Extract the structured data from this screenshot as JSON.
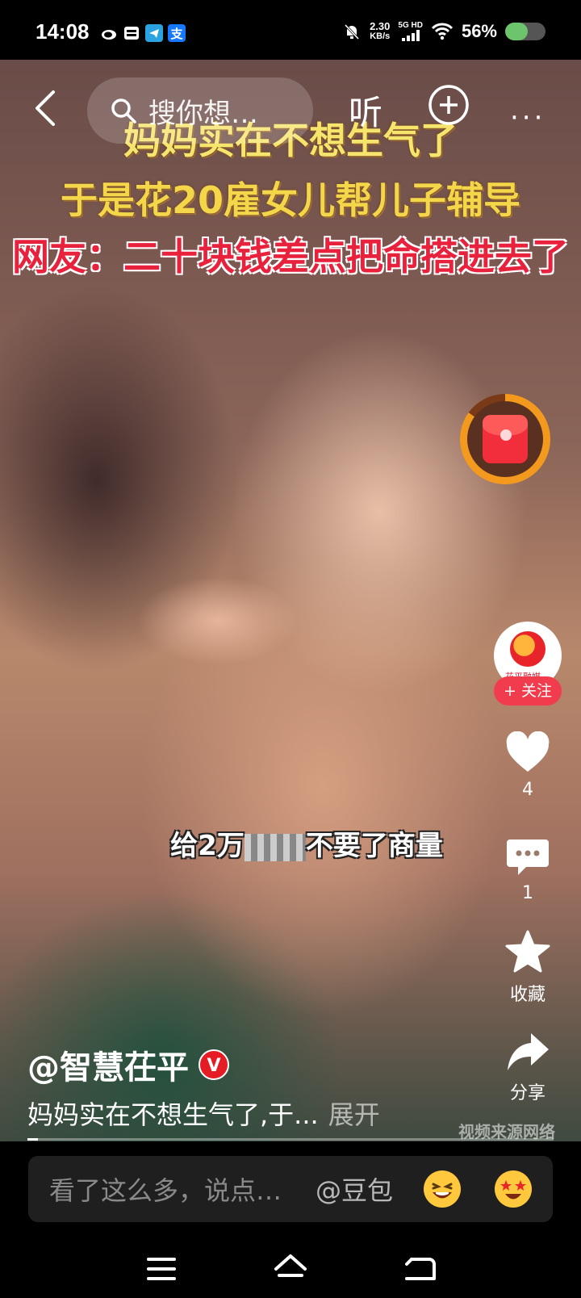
{
  "status_bar": {
    "time": "14:08",
    "net_speed_value": "2.30",
    "net_speed_unit": "KB/s",
    "signal_label": "5G HD",
    "battery_text": "56%",
    "battery_level": 0.56,
    "left_icons": [
      "weibo-icon",
      "sim-card-icon",
      "telegram-icon",
      "alipay-icon"
    ],
    "right_icons": [
      "mute-bell-icon",
      "signal-icon",
      "wifi-icon",
      "battery-icon"
    ]
  },
  "top_nav": {
    "search_placeholder": "搜你想…",
    "listen_label": "听",
    "more_label": "···"
  },
  "video": {
    "headline_1": "妈妈实在不想生气了",
    "headline_2": "于是花20雇女儿帮儿子辅导",
    "headline_3": "网友：二十块钱差点把命搭进去了",
    "subtitle_before": "给2万",
    "subtitle_after": "不要了商量",
    "watermark": "视频来源网络",
    "progress": 0.02
  },
  "sidebar": {
    "avatar_text": "花平融媒",
    "follow_label": "+ 关注",
    "like_count": "4",
    "comment_count": "1",
    "favorite_label": "收藏",
    "share_label": "分享"
  },
  "post": {
    "author": "@智慧茌平",
    "verified_badge": "V",
    "description": "妈妈实在不想生气了,于...",
    "expand_label": "展开"
  },
  "comment_bar": {
    "placeholder": "看了这么多，说点…",
    "mention": "@豆包"
  },
  "colors": {
    "accent_red": "#f03c4c",
    "redpacket_ring": "#f39a1e",
    "battery_green": "#6cc56c",
    "headline_yellow": "#f4d64a",
    "headline_red": "#e8223c"
  }
}
